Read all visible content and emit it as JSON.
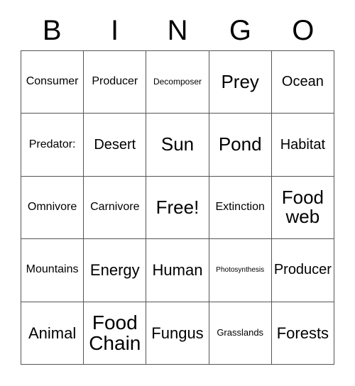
{
  "card": {
    "title": "BINGO",
    "header_letters": [
      "B",
      "I",
      "N",
      "G",
      "O"
    ],
    "columns": 5,
    "rows": 5,
    "free_space": "Free!",
    "free_space_position": "center",
    "border_color": "#555555",
    "background_color": "#ffffff",
    "text_color": "#000000",
    "grid": [
      [
        {
          "label": "Consumer",
          "size": "fs-md"
        },
        {
          "label": "Producer",
          "size": "fs-md"
        },
        {
          "label": "Decomposer",
          "size": "fs-sm"
        },
        {
          "label": "Prey",
          "size": "fs-xxl"
        },
        {
          "label": "Ocean",
          "size": "fs-lg"
        }
      ],
      [
        {
          "label": "Predator:",
          "size": "fs-md"
        },
        {
          "label": "Desert",
          "size": "fs-lg"
        },
        {
          "label": "Sun",
          "size": "fs-xxl"
        },
        {
          "label": "Pond",
          "size": "fs-xxl"
        },
        {
          "label": "Habitat",
          "size": "fs-lg"
        }
      ],
      [
        {
          "label": "Omnivore",
          "size": "fs-md"
        },
        {
          "label": "Carnivore",
          "size": "fs-md"
        },
        {
          "label": "Free!",
          "size": "fs-xxl"
        },
        {
          "label": "Extinction",
          "size": "fs-md"
        },
        {
          "label": "Food web",
          "size": "fs-xxl"
        }
      ],
      [
        {
          "label": "Mountains",
          "size": "fs-md"
        },
        {
          "label": "Energy",
          "size": "fs-xl"
        },
        {
          "label": "Human",
          "size": "fs-xl"
        },
        {
          "label": "Photosynthesis",
          "size": "fs-xs"
        },
        {
          "label": "Producer",
          "size": "fs-lg"
        }
      ],
      [
        {
          "label": "Animal",
          "size": "fs-xl"
        },
        {
          "label": "Food Chain",
          "size": "fs-xxxl"
        },
        {
          "label": "Fungus",
          "size": "fs-xl"
        },
        {
          "label": "Grasslands",
          "size": "fs-sm2"
        },
        {
          "label": "Forests",
          "size": "fs-xl"
        }
      ]
    ]
  }
}
